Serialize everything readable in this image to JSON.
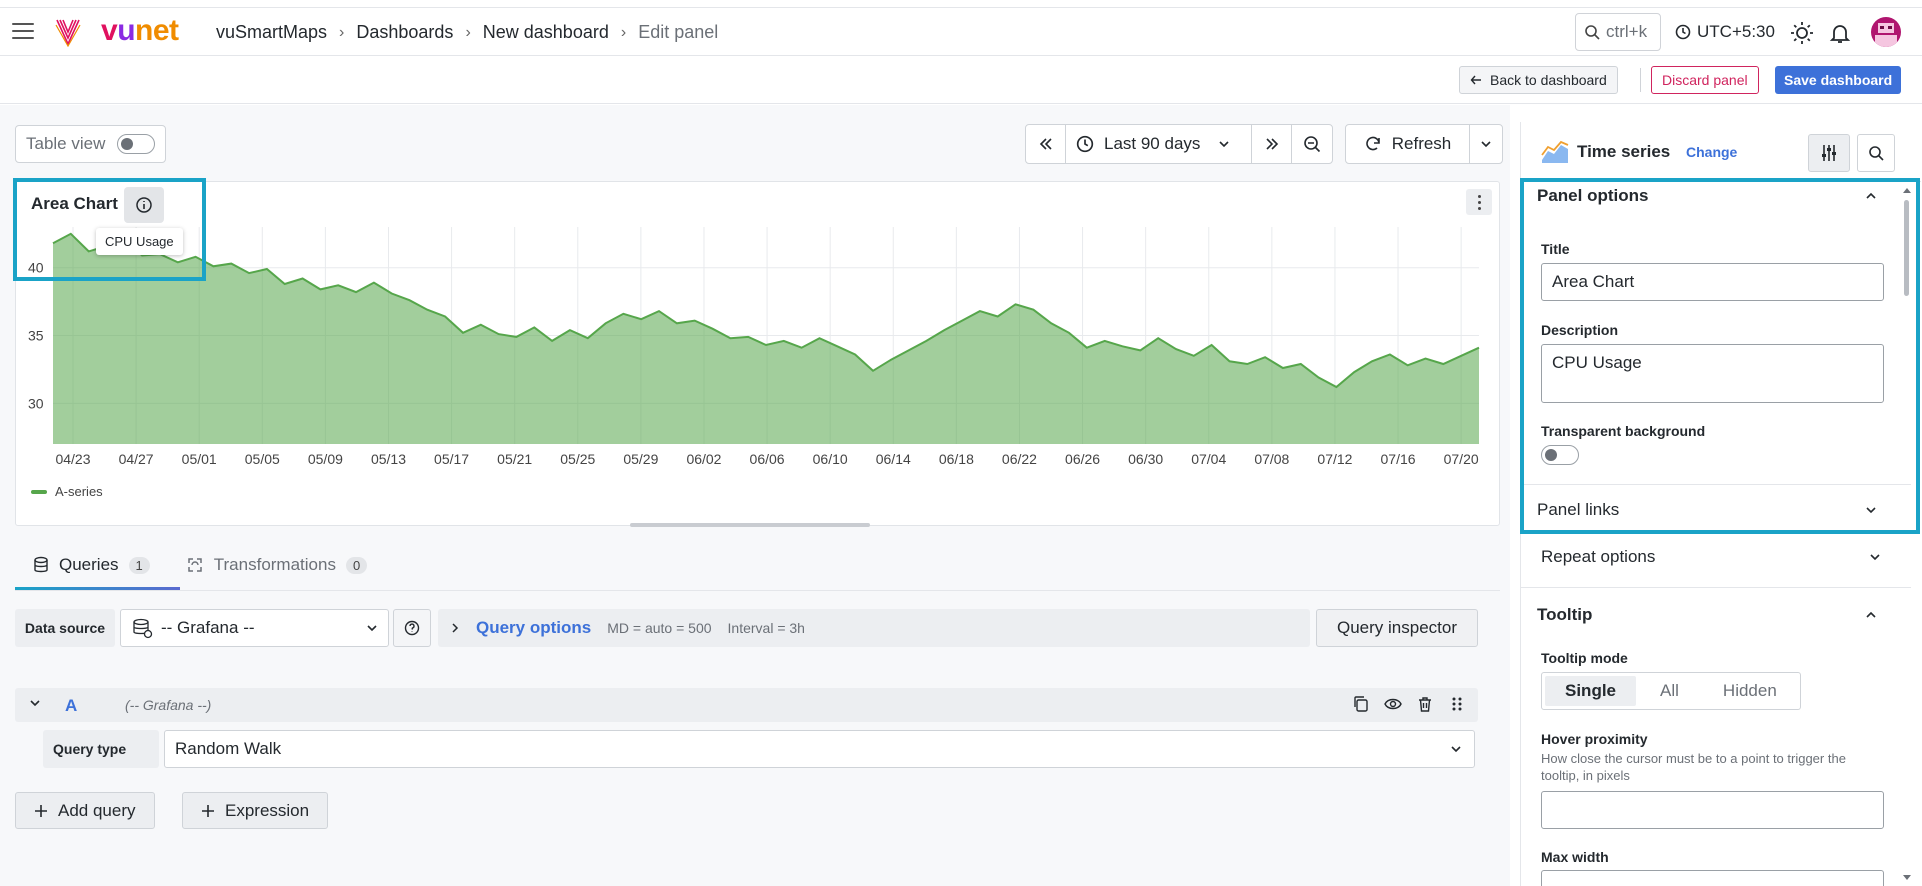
{
  "brand": {
    "v": "v",
    "u": "u",
    "net": "net"
  },
  "breadcrumb": {
    "items": [
      "vuSmartMaps",
      "Dashboards",
      "New dashboard",
      "Edit panel"
    ],
    "sep": "›"
  },
  "topbar": {
    "search_hint": "ctrl+k",
    "timezone": "UTC+5:30"
  },
  "actions": {
    "back": "Back to dashboard",
    "discard": "Discard panel",
    "save": "Save dashboard"
  },
  "toolbar": {
    "table_view": "Table view",
    "time_range": "Last 90 days",
    "refresh": "Refresh"
  },
  "panel": {
    "title": "Area Chart",
    "tooltip": "CPU Usage",
    "legend": "A-series"
  },
  "chart_data": {
    "type": "area",
    "title": "Area Chart",
    "x_tick_labels": [
      "04/23",
      "04/27",
      "05/01",
      "05/05",
      "05/09",
      "05/13",
      "05/17",
      "05/21",
      "05/25",
      "05/29",
      "06/02",
      "06/06",
      "06/10",
      "06/14",
      "06/18",
      "06/22",
      "06/26",
      "06/30",
      "07/04",
      "07/08",
      "07/12",
      "07/16",
      "07/20"
    ],
    "y_tick_labels": [
      "40",
      "35",
      "30"
    ],
    "ylim": [
      27,
      43
    ],
    "series": [
      {
        "name": "A-series",
        "color": "#56a64b",
        "values": [
          41.8,
          42.5,
          41.2,
          41.6,
          42.1,
          40.9,
          41.0,
          40.4,
          40.8,
          40.1,
          40.3,
          39.6,
          39.9,
          38.8,
          39.2,
          38.4,
          38.7,
          38.2,
          38.9,
          38.1,
          37.6,
          36.9,
          36.4,
          35.2,
          35.8,
          35.1,
          34.9,
          35.6,
          34.6,
          35.4,
          34.8,
          35.9,
          36.6,
          36.2,
          36.8,
          35.9,
          36.1,
          35.5,
          34.8,
          34.9,
          34.3,
          34.6,
          34.1,
          34.8,
          34.2,
          33.6,
          32.4,
          33.2,
          33.9,
          34.6,
          35.4,
          36.1,
          36.8,
          36.4,
          37.3,
          36.9,
          35.9,
          35.2,
          34.1,
          34.6,
          34.2,
          33.9,
          34.8,
          34.0,
          33.5,
          34.3,
          33.1,
          32.9,
          33.4,
          32.6,
          32.9,
          31.9,
          31.2,
          32.3,
          33.1,
          33.6,
          32.8,
          33.3,
          32.9,
          33.5,
          34.1
        ]
      }
    ],
    "grid": true,
    "legend_position": "bottom-left"
  },
  "queries": {
    "tab_queries": "Queries",
    "queries_count": "1",
    "tab_transformations": "Transformations",
    "transformations_count": "0",
    "datasource_label": "Data source",
    "datasource_value": "-- Grafana --",
    "query_options": "Query options",
    "md_info": "MD = auto = 500",
    "interval_info": "Interval = 3h",
    "inspector": "Query inspector",
    "row_letter": "A",
    "row_ds": "(-- Grafana --)",
    "query_type_label": "Query type",
    "query_type_value": "Random Walk",
    "add_query": "Add query",
    "expression": "Expression"
  },
  "options": {
    "viz_name": "Time series",
    "change": "Change",
    "panel_options": "Panel options",
    "title_label": "Title",
    "title_value": "Area Chart",
    "description_label": "Description",
    "description_value": "CPU Usage",
    "transparent_label": "Transparent background",
    "panel_links": "Panel links",
    "repeat_options": "Repeat options",
    "tooltip_section": "Tooltip",
    "tooltip_mode_label": "Tooltip mode",
    "tooltip_modes": [
      "Single",
      "All",
      "Hidden"
    ],
    "hover_label": "Hover proximity",
    "hover_help": "How close the cursor must be to a point to trigger the tooltip, in pixels",
    "max_width_label": "Max width"
  },
  "colors": {
    "accent": "#3d71d9",
    "danger": "#d0245e",
    "highlight": "#1aa3c7",
    "series": "#56a64b"
  }
}
